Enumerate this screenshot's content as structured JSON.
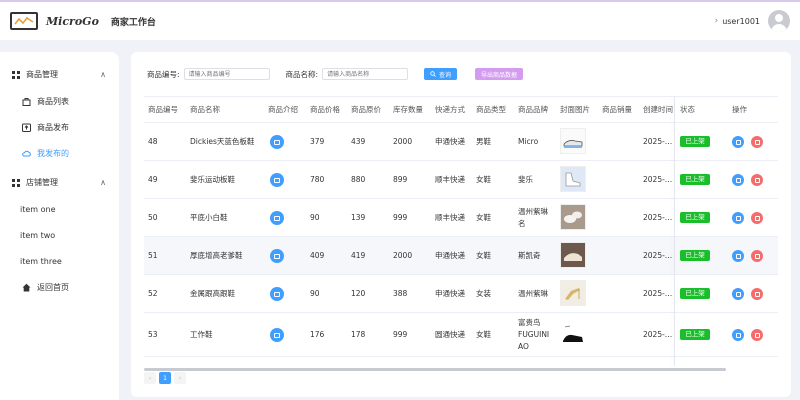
{
  "header": {
    "brand": "MicroGo",
    "subtitle": "商家工作台",
    "username": "user1001",
    "chevron": "›"
  },
  "sidebar": {
    "group1": {
      "label": "商品管理",
      "icon": "grid-icon",
      "arrow": "∧"
    },
    "items1": [
      {
        "label": "商品列表",
        "icon": "bag-icon"
      },
      {
        "label": "商品发布",
        "icon": "upload-box-icon"
      },
      {
        "label": "我发布的",
        "icon": "cloud-icon"
      }
    ],
    "group2": {
      "label": "店铺管理",
      "icon": "grid-icon",
      "arrow": "∧"
    },
    "items2": [
      {
        "label": "item one"
      },
      {
        "label": "item two"
      },
      {
        "label": "item three"
      }
    ],
    "home": {
      "label": "返回首页",
      "icon": "home-icon"
    }
  },
  "filter": {
    "code_label": "商品编号:",
    "code_placeholder": "请输入商品编号",
    "name_label": "商品名称:",
    "name_placeholder": "请输入商品名称",
    "search_label": "查询",
    "export_label": "导出商品数据"
  },
  "table": {
    "headers": [
      "商品编号",
      "商品名称",
      "商品介绍",
      "商品价格",
      "商品原价",
      "库存数量",
      "快递方式",
      "商品类型",
      "商品品牌",
      "封面图片",
      "商品销量",
      "创建时间",
      "状态",
      "操作"
    ],
    "rows": [
      {
        "id": "48",
        "name": "Dickies天蓝色板鞋",
        "price": "379",
        "orig": "439",
        "stock": "2000",
        "ship": "申通快递",
        "type": "男鞋",
        "brand": "Micro",
        "brand2": "",
        "brand3": "",
        "time": "2025-…",
        "status": "已上架"
      },
      {
        "id": "49",
        "name": "斐乐运动板鞋",
        "price": "780",
        "orig": "880",
        "stock": "899",
        "ship": "顺丰快递",
        "type": "女鞋",
        "brand": "斐乐",
        "brand2": "",
        "brand3": "",
        "time": "2025-…",
        "status": "已上架"
      },
      {
        "id": "50",
        "name": "平底小白鞋",
        "price": "90",
        "orig": "139",
        "stock": "999",
        "ship": "顺丰快递",
        "type": "女鞋",
        "brand": "温州紫琳",
        "brand2": "名",
        "brand3": "",
        "time": "2025-…",
        "status": "已上架"
      },
      {
        "id": "51",
        "name": "厚底增高老爹鞋",
        "price": "409",
        "orig": "419",
        "stock": "2000",
        "ship": "申通快递",
        "type": "女鞋",
        "brand": "斯凯奇",
        "brand2": "",
        "brand3": "",
        "time": "2025-…",
        "status": "已上架"
      },
      {
        "id": "52",
        "name": "金属跟高跟鞋",
        "price": "90",
        "orig": "120",
        "stock": "388",
        "ship": "申通快递",
        "type": "女装",
        "brand": "温州紫琳",
        "brand2": "",
        "brand3": "",
        "time": "2025-…",
        "status": "已上架"
      },
      {
        "id": "53",
        "name": "工作鞋",
        "price": "176",
        "orig": "178",
        "stock": "999",
        "ship": "圆通快递",
        "type": "女鞋",
        "brand": "富贵鸟",
        "brand2": "FUGUINI",
        "brand3": "AO",
        "time": "2025-…",
        "status": "已上架"
      }
    ]
  },
  "pager": {
    "prev": "‹",
    "current": "1",
    "next": "›"
  },
  "colors": {
    "primary": "#409eff",
    "status": "#19be2a",
    "danger": "#f56c6c",
    "export": "#d49cf0"
  }
}
